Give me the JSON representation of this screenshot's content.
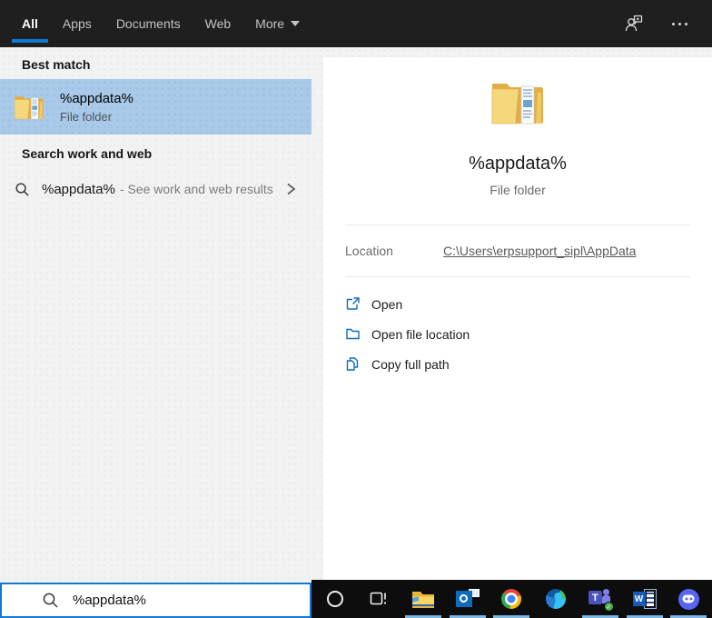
{
  "header": {
    "tabs": [
      {
        "label": "All",
        "active": true
      },
      {
        "label": "Apps",
        "active": false
      },
      {
        "label": "Documents",
        "active": false
      },
      {
        "label": "Web",
        "active": false
      },
      {
        "label": "More",
        "active": false,
        "has_dropdown": true
      }
    ],
    "icons": [
      "account-feedback-icon",
      "ellipsis-icon"
    ]
  },
  "left_panel": {
    "best_match": {
      "section_title": "Best match",
      "result": {
        "title": "%appdata%",
        "subtitle": "File folder",
        "icon": "folder-icon",
        "selected": true
      }
    },
    "web_search": {
      "section_title": "Search work and web",
      "result": {
        "query": "%appdata%",
        "suffix": "- See work and web results",
        "icon": "search-icon",
        "chevron": "chevron-right-icon"
      }
    }
  },
  "preview_panel": {
    "icon": "folder-icon",
    "title": "%appdata%",
    "subtitle": "File folder",
    "location": {
      "label": "Location",
      "value": "C:\\Users\\erpsupport_sipl\\AppData"
    },
    "actions": [
      {
        "label": "Open",
        "icon": "open-external-icon"
      },
      {
        "label": "Open file location",
        "icon": "folder-outline-icon"
      },
      {
        "label": "Copy full path",
        "icon": "copy-icon"
      }
    ]
  },
  "search_box": {
    "value": "%appdata%",
    "icon": "search-icon"
  },
  "taskbar": {
    "items": [
      {
        "name": "cortana",
        "running": false,
        "glyph": ""
      },
      {
        "name": "task-view",
        "running": false,
        "glyph": ""
      },
      {
        "name": "file-explorer",
        "running": true,
        "glyph": ""
      },
      {
        "name": "outlook",
        "running": true,
        "glyph": ""
      },
      {
        "name": "chrome",
        "running": true,
        "glyph": ""
      },
      {
        "name": "edge",
        "running": false,
        "glyph": ""
      },
      {
        "name": "teams",
        "running": true,
        "glyph": "T"
      },
      {
        "name": "word",
        "running": true,
        "glyph": "W"
      },
      {
        "name": "discord",
        "running": true,
        "glyph": ""
      }
    ],
    "badge_check": "✓"
  },
  "colors": {
    "accent_blue": "#0f78d4",
    "highlight_blue": "#a9c9e8",
    "taskbar_indicator": "#7ab8e8",
    "topbar_bg": "#1f1f1f",
    "taskbar_bg": "#0d0d0d",
    "panel_bg": "#f2f2f2",
    "action_icon_blue": "#0f6cbd"
  }
}
